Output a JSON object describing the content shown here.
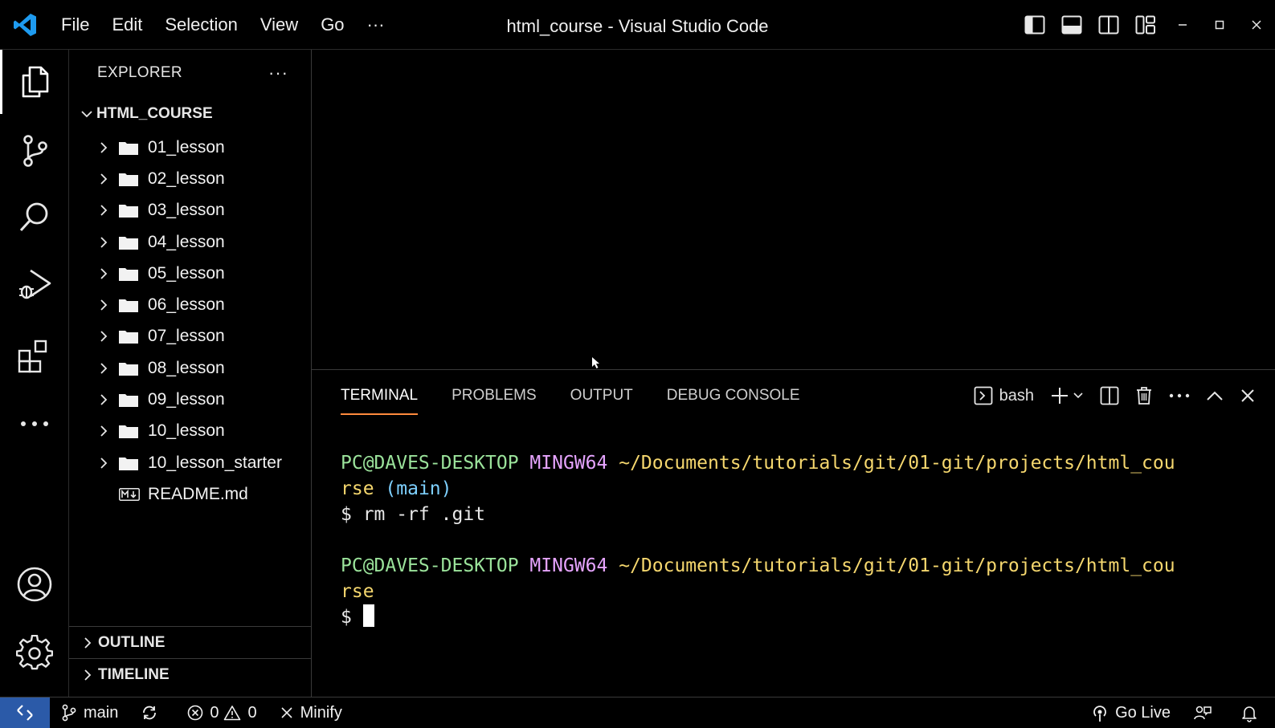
{
  "window": {
    "title": "html_course - Visual Studio Code",
    "menu": [
      "File",
      "Edit",
      "Selection",
      "View",
      "Go",
      "···"
    ]
  },
  "activity_bar": {
    "items": [
      "explorer-icon",
      "source-control-icon",
      "search-icon",
      "run-debug-icon",
      "extensions-icon",
      "more-icon"
    ],
    "bottom": [
      "account-icon",
      "settings-gear-icon"
    ]
  },
  "explorer": {
    "title": "EXPLORER",
    "more": "···",
    "root": "HTML_COURSE",
    "items": [
      {
        "label": "01_lesson",
        "type": "folder"
      },
      {
        "label": "02_lesson",
        "type": "folder"
      },
      {
        "label": "03_lesson",
        "type": "folder"
      },
      {
        "label": "04_lesson",
        "type": "folder"
      },
      {
        "label": "05_lesson",
        "type": "folder"
      },
      {
        "label": "06_lesson",
        "type": "folder"
      },
      {
        "label": "07_lesson",
        "type": "folder"
      },
      {
        "label": "08_lesson",
        "type": "folder"
      },
      {
        "label": "09_lesson",
        "type": "folder"
      },
      {
        "label": "10_lesson",
        "type": "folder"
      },
      {
        "label": "10_lesson_starter",
        "type": "folder"
      },
      {
        "label": "README.md",
        "type": "markdown"
      }
    ],
    "outline": "OUTLINE",
    "timeline": "TIMELINE"
  },
  "panel": {
    "tabs": [
      "TERMINAL",
      "PROBLEMS",
      "OUTPUT",
      "DEBUG CONSOLE"
    ],
    "active_tab": "TERMINAL",
    "shell": "bash"
  },
  "terminal": {
    "user": "PC@DAVES-DESKTOP",
    "host": "MINGW64",
    "path_1": "~/Documents/tutorials/git/01-git/projects/html_cou",
    "path_2": "rse",
    "branch": "(main)",
    "command": "$ rm -rf .git",
    "prompt": "$"
  },
  "status_bar": {
    "branch": "main",
    "errors": "0",
    "warnings": "0",
    "minify": "Minify",
    "go_live": "Go Live"
  },
  "colors": {
    "accent": "#ff8a3d",
    "remote": "#2b5aa8",
    "vscode_blue": "#1e9bf0"
  }
}
